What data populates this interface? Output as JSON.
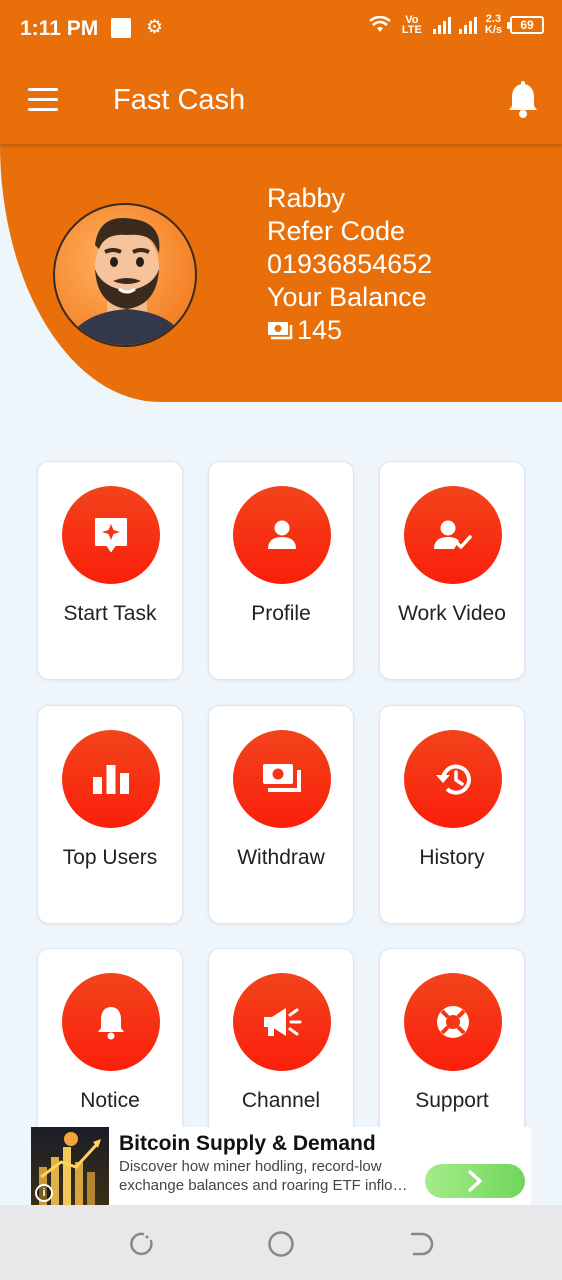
{
  "status_bar": {
    "time": "1:11 PM",
    "network_label": "Vo LTE",
    "speed_value": "2.3",
    "speed_unit": "K/s",
    "battery": "69"
  },
  "app_bar": {
    "title": "Fast Cash",
    "menu_icon": "hamburger-menu-icon",
    "notification_icon": "bell-icon"
  },
  "profile": {
    "name": "Rabby",
    "refer_label": "Refer Code",
    "refer_code": "01936854652",
    "balance_label": "Your Balance",
    "balance": "145"
  },
  "menu": [
    {
      "label": "Start Task",
      "icon": "task-star-icon"
    },
    {
      "label": "Profile",
      "icon": "person-icon"
    },
    {
      "label": "Work Video",
      "icon": "person-check-icon"
    },
    {
      "label": "Top Users",
      "icon": "bar-chart-icon"
    },
    {
      "label": "Withdraw",
      "icon": "money-icon"
    },
    {
      "label": "History",
      "icon": "history-icon"
    },
    {
      "label": "Notice",
      "icon": "bell-icon"
    },
    {
      "label": "Channel",
      "icon": "megaphone-icon"
    },
    {
      "label": "Support",
      "icon": "lifebuoy-icon"
    }
  ],
  "ad": {
    "title": "Bitcoin Supply & Demand",
    "description": "Discover how miner hodling, record-low exchange balances and roaring ETF inflo…",
    "cta_icon": "chevron-right-icon"
  },
  "colors": {
    "primary": "#e86f0a",
    "icon_circle": "#f53615",
    "background": "#eef5fb"
  }
}
